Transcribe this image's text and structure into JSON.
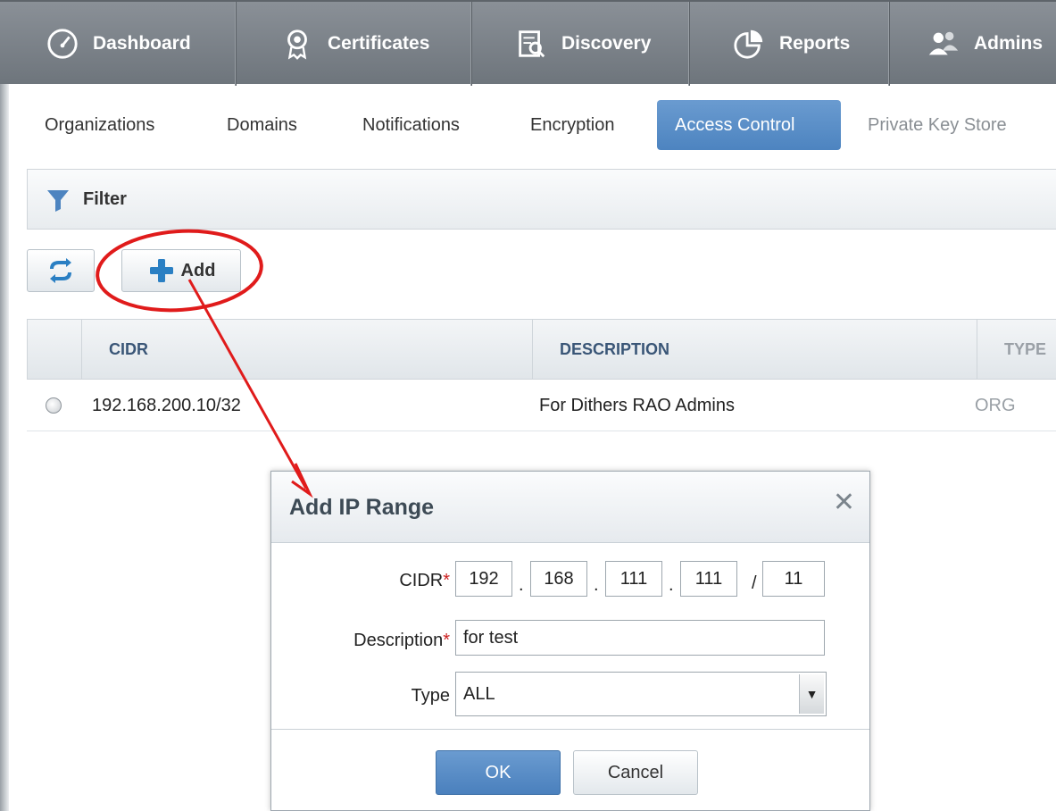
{
  "topnav": {
    "items": [
      {
        "label": "Dashboard",
        "icon": "dashboard-gauge-icon"
      },
      {
        "label": "Certificates",
        "icon": "certificate-badge-icon"
      },
      {
        "label": "Discovery",
        "icon": "discovery-scan-icon"
      },
      {
        "label": "Reports",
        "icon": "reports-pie-icon"
      },
      {
        "label": "Admins",
        "icon": "admins-users-icon"
      }
    ]
  },
  "subtabs": {
    "items": [
      {
        "label": "Organizations",
        "state": "normal"
      },
      {
        "label": "Domains",
        "state": "normal"
      },
      {
        "label": "Notifications",
        "state": "normal"
      },
      {
        "label": "Encryption",
        "state": "normal"
      },
      {
        "label": "Access Control",
        "state": "active"
      },
      {
        "label": "Private Key Store",
        "state": "muted"
      }
    ]
  },
  "filter": {
    "label": "Filter",
    "icon": "funnel-icon"
  },
  "toolbar": {
    "refresh_icon": "refresh-icon",
    "add_label": "Add",
    "add_icon": "plus-icon"
  },
  "table": {
    "columns": [
      "CIDR",
      "DESCRIPTION",
      "TYPE"
    ],
    "rows": [
      {
        "cidr": "192.168.200.10/32",
        "description": "For Dithers RAO Admins",
        "type": "ORG"
      }
    ]
  },
  "dialog": {
    "title": "Add IP Range",
    "close_symbol": "✕",
    "cidr_label": "CIDR",
    "required_mark": "*",
    "cidr": {
      "oct1": "192",
      "oct2": "168",
      "oct3": "111",
      "oct4": "111",
      "mask": "11",
      "dot": ".",
      "slash": "/"
    },
    "description_label": "Description",
    "description_value": "for test",
    "type_label": "Type",
    "type_value": "ALL",
    "ok_label": "OK",
    "cancel_label": "Cancel"
  },
  "annotation": {
    "color": "#e01b1b"
  },
  "colors": {
    "accent": "#4d84c0",
    "nav": "#7a8087",
    "header_text": "#3a5677",
    "required": "#cc1f1f"
  }
}
